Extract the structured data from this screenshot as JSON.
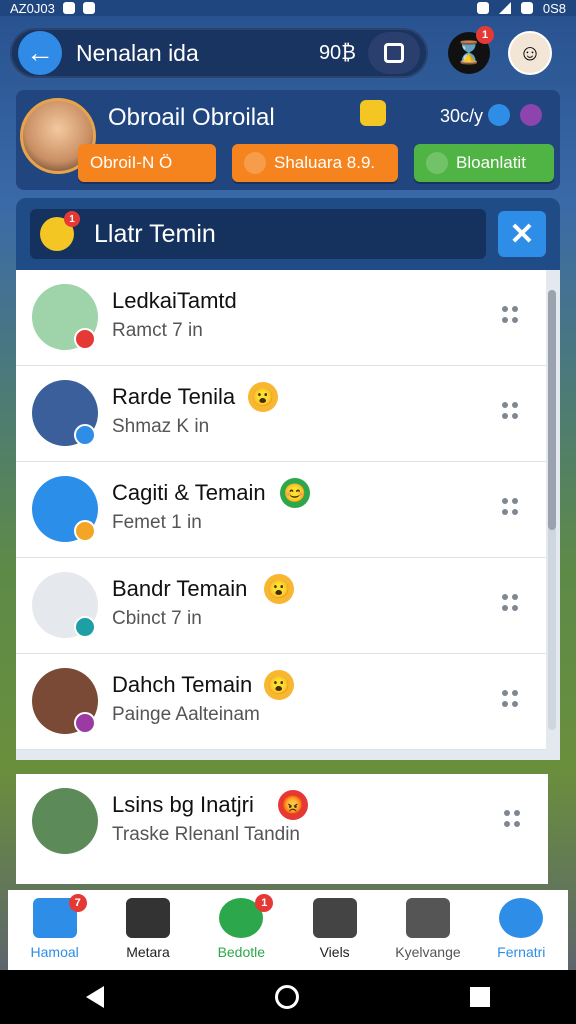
{
  "status_bar": {
    "time": "AZ0J03",
    "battery": "0S8"
  },
  "top_bar": {
    "title": "Nenalan ida",
    "coins": "90₿",
    "notifications_badge": "1"
  },
  "profile": {
    "name": "Obroail Obroilal",
    "points": "30c/y",
    "chips": [
      {
        "label": "ObroiI-N Ö",
        "color": "#f5841f"
      },
      {
        "label": "Shaluara 8.9.",
        "color": "#f5841f"
      },
      {
        "label": "Bloanlatit",
        "color": "#4fb443"
      }
    ]
  },
  "list_header": {
    "title": "Llatr Temin",
    "badge": "1"
  },
  "friends": [
    {
      "name": "LedkaiTamtd",
      "sub": "Ramct 7 in",
      "emoji": "",
      "avatar_color": "#9fd3a9",
      "status_color": "#e53935"
    },
    {
      "name": "Rarde Tenila",
      "sub": "Shmaz K in",
      "emoji": "😮",
      "avatar_color": "#3b5f9a",
      "status_color": "#2e8de6"
    },
    {
      "name": "Cagiti & Temain",
      "sub": "Femet 1 in",
      "emoji": "😊",
      "avatar_color": "#2b8ee8",
      "status_color": "#f3a526"
    },
    {
      "name": "Bandr Temain",
      "sub": "Cbinct 7 in",
      "emoji": "😮",
      "avatar_color": "#e5e8ec",
      "status_color": "#1e9fa4"
    },
    {
      "name": "Dahch Temain",
      "sub": "Painge Aalteinam",
      "emoji": "😮",
      "avatar_color": "#7a4a36",
      "status_color": "#9c3aa3"
    },
    {
      "name": "Lsins bg Inatjri",
      "sub": "Traske Rlenanl Tandin",
      "emoji": "😡",
      "avatar_color": "#5c8a58",
      "status_color": ""
    }
  ],
  "bottom_nav": [
    {
      "label": "Hamoal",
      "color": "#2e8de6",
      "badge": "7"
    },
    {
      "label": "Metara",
      "color": "#222",
      "badge": ""
    },
    {
      "label": "Bedotle",
      "color": "#2ca74b",
      "badge": "1"
    },
    {
      "label": "Viels",
      "color": "#222",
      "badge": ""
    },
    {
      "label": "Kyelvange",
      "color": "#555",
      "badge": ""
    },
    {
      "label": "Fernatri",
      "color": "#2e8de6",
      "badge": ""
    }
  ]
}
